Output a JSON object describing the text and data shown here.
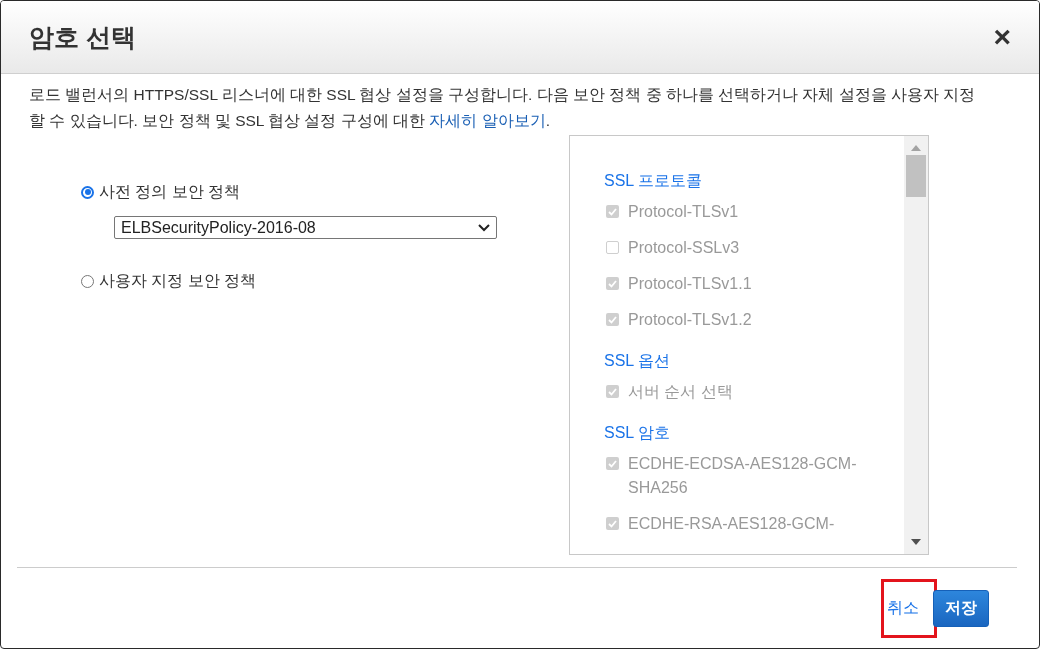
{
  "dialog": {
    "title": "암호 선택",
    "close": "×"
  },
  "description": {
    "text": "로드 밸런서의 HTTPS/SSL 리스너에 대한 SSL 협상 설정을 구성합니다. 다음 보안 정책 중 하나를 선택하거나 자체 설정을 사용자 지정할 수 있습니다. 보안 정책 및 SSL 협상 설정 구성에 대한 ",
    "link": "자세히 알아보기",
    "end": "."
  },
  "policy_options": [
    {
      "label": "사전 정의 보안 정책",
      "selected": true,
      "select_value": "ELBSecurityPolicy-2016-08"
    },
    {
      "label": "사용자 지정 보안 정책",
      "selected": false
    }
  ],
  "ssl_sections": [
    {
      "title": "SSL 프로토콜",
      "options": [
        {
          "label": "Protocol-TLSv1",
          "checked": true,
          "disabled": true
        },
        {
          "label": "Protocol-SSLv3",
          "checked": false,
          "disabled": true
        },
        {
          "label": "Protocol-TLSv1.1",
          "checked": true,
          "disabled": true
        },
        {
          "label": "Protocol-TLSv1.2",
          "checked": true,
          "disabled": true
        }
      ]
    },
    {
      "title": "SSL 옵션",
      "options": [
        {
          "label": "서버 순서 선택",
          "checked": true,
          "disabled": true
        }
      ]
    },
    {
      "title": "SSL 암호",
      "options": [
        {
          "label": "ECDHE-ECDSA-AES128-GCM-SHA256",
          "checked": true,
          "disabled": true
        },
        {
          "label": "ECDHE-RSA-AES128-GCM-",
          "checked": true,
          "disabled": true
        }
      ]
    }
  ],
  "buttons": [
    {
      "label": "취소",
      "kind": "link",
      "highlighted": true
    },
    {
      "label": "저장",
      "kind": "primary",
      "highlighted": false
    }
  ]
}
